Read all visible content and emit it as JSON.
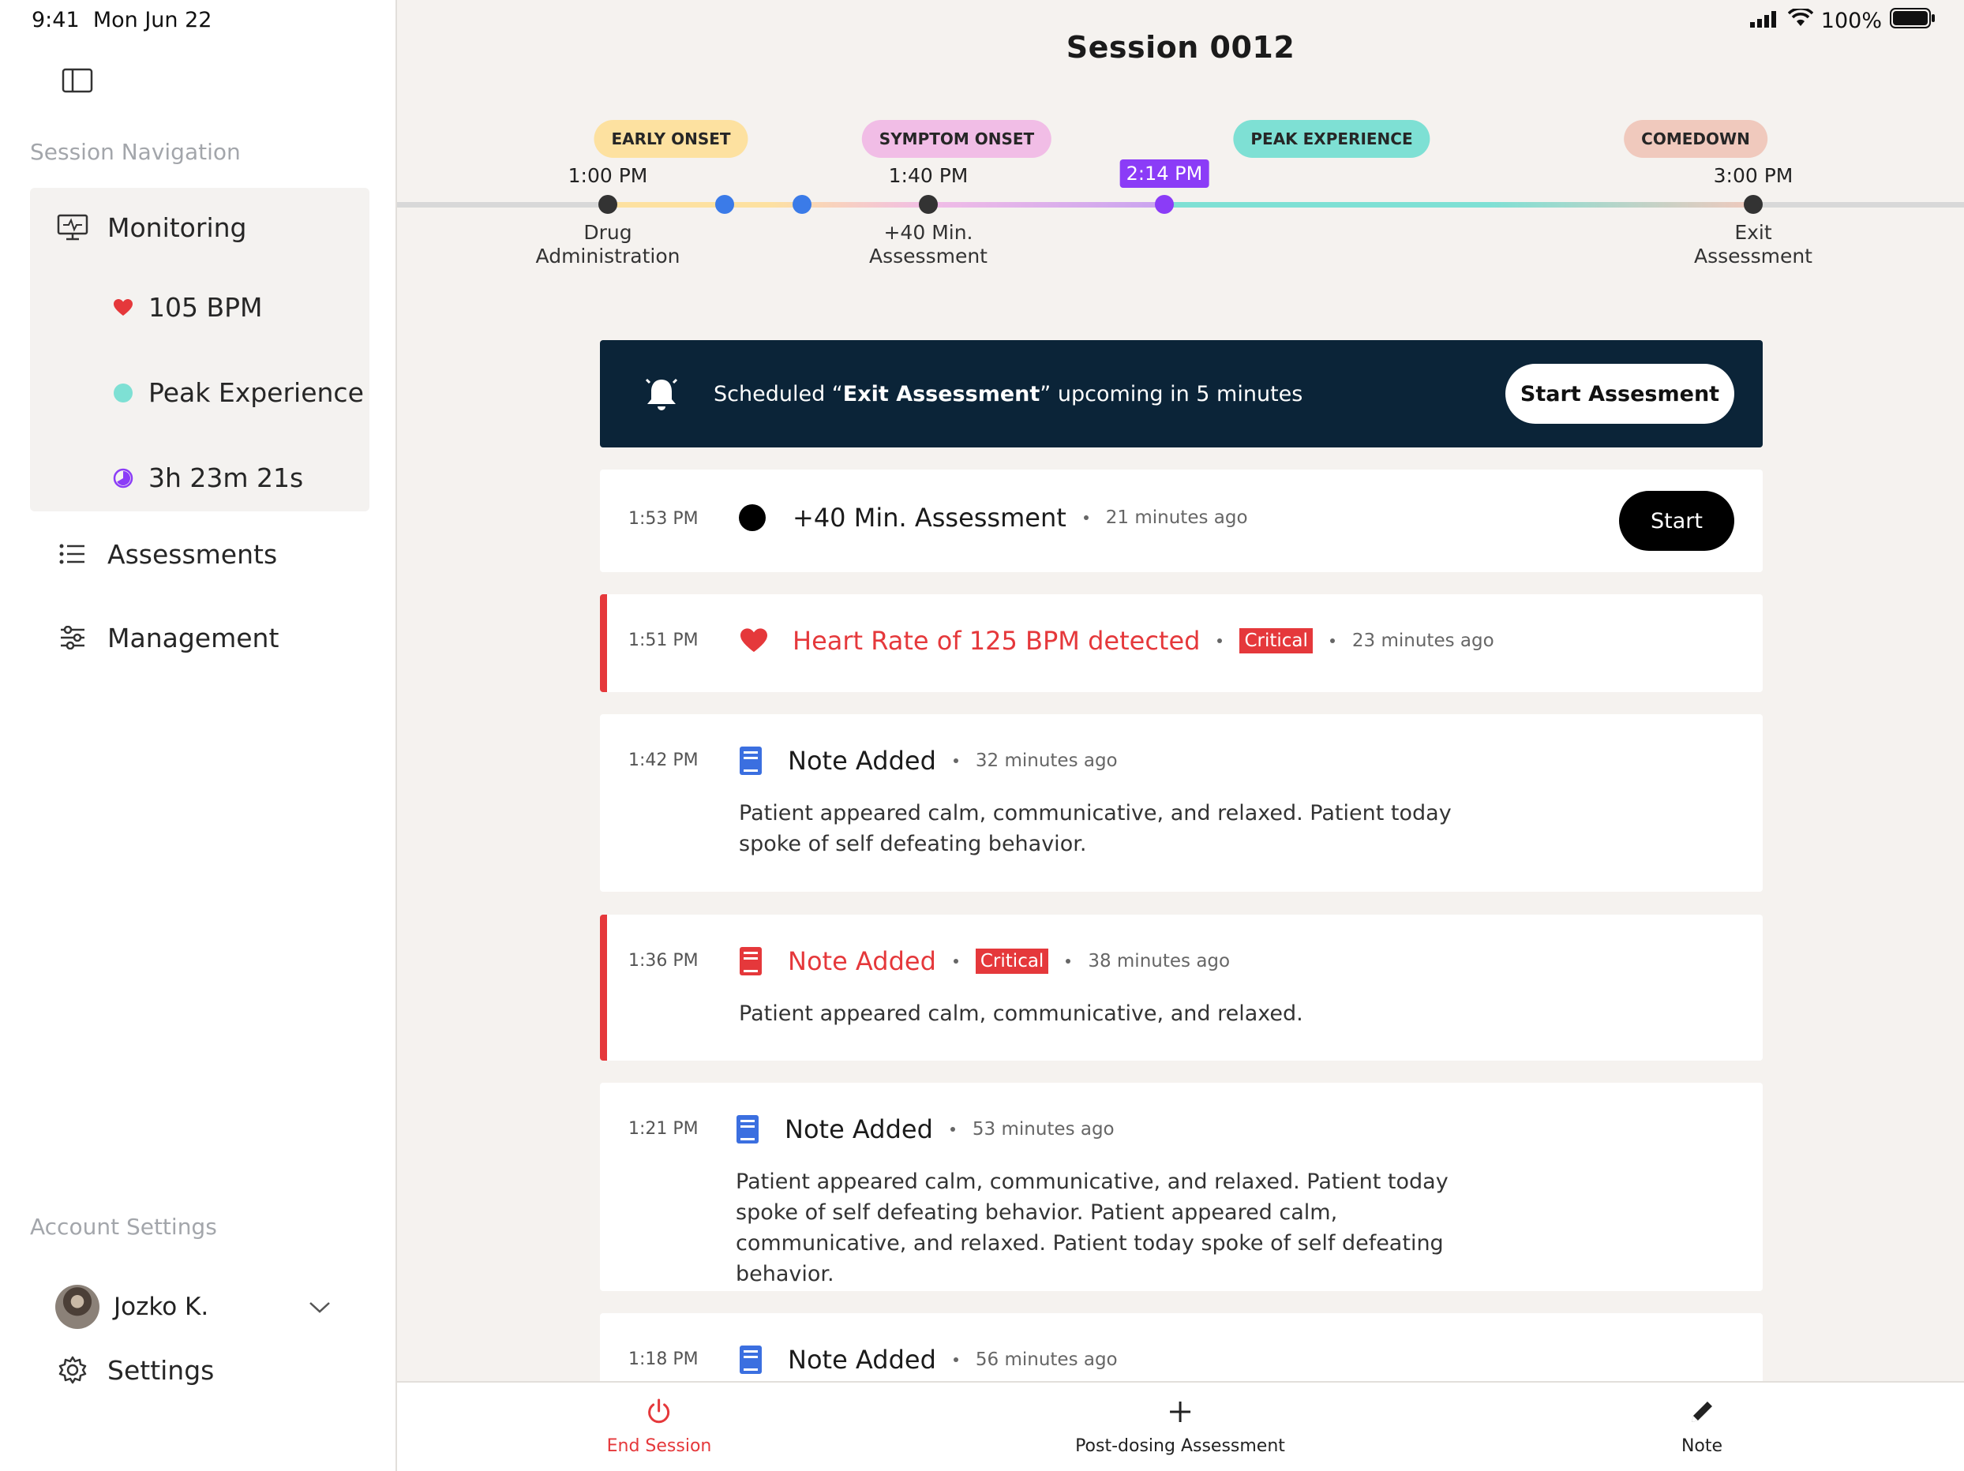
{
  "status_bar": {
    "time": "9:41",
    "date": "Mon Jun 22",
    "battery": "100%"
  },
  "session": {
    "title": "Session 0012"
  },
  "sidebar": {
    "nav_heading": "Session Navigation",
    "monitoring": {
      "label": "Monitoring",
      "heart_rate": "105 BPM",
      "phase": "Peak Experience",
      "elapsed": "3h 23m 21s"
    },
    "items": [
      {
        "label": "Assessments",
        "icon": "list-icon"
      },
      {
        "label": "Management",
        "icon": "sliders-icon"
      }
    ],
    "account_heading": "Account Settings",
    "user": {
      "name": "Jozko K."
    },
    "settings_label": "Settings"
  },
  "timeline": {
    "phases": [
      {
        "label": "EARLY ONSET",
        "color": "#fde1a0"
      },
      {
        "label": "SYMPTOM ONSET",
        "color": "#f1bde6"
      },
      {
        "label": "PEAK EXPERIENCE",
        "color": "#7ee0d4"
      },
      {
        "label": "COMEDOWN",
        "color": "#f0c9bd"
      }
    ],
    "times": [
      "1:00 PM",
      "1:40 PM",
      "3:00 PM"
    ],
    "current_time": "2:14 PM",
    "events": [
      {
        "label_line1": "Drug",
        "label_line2": "Administration"
      },
      {
        "label_line1": "+40 Min.",
        "label_line2": "Assessment"
      },
      {
        "label_line1": "Exit",
        "label_line2": "Assessment"
      }
    ]
  },
  "banner": {
    "prefix": "Scheduled “",
    "emphasis": "Exit Assessment",
    "suffix": "” upcoming in 5 minutes",
    "button": "Start Assesment"
  },
  "feed": [
    {
      "time": "1:53 PM",
      "title": "+40 Min. Assessment",
      "ago": "21 minutes ago",
      "button": "Start"
    },
    {
      "time": "1:51 PM",
      "title": "Heart Rate of 125 BPM detected",
      "badge": "Critical",
      "ago": "23 minutes ago"
    },
    {
      "time": "1:42 PM",
      "title": "Note Added",
      "ago": "32 minutes ago",
      "body": "Patient appeared calm, communicative, and relaxed. Patient today spoke of self defeating behavior."
    },
    {
      "time": "1:36 PM",
      "title": "Note Added",
      "badge": "Critical",
      "ago": "38 minutes ago",
      "body": "Patient appeared calm, communicative, and relaxed."
    },
    {
      "time": "1:21 PM",
      "title": "Note Added",
      "ago": "53 minutes ago",
      "body": "Patient appeared calm, communicative, and relaxed. Patient today spoke of self defeating behavior. Patient appeared calm, communicative, and relaxed. Patient today spoke of self defeating behavior."
    },
    {
      "time": "1:18 PM",
      "title": "Note Added",
      "ago": "56 minutes ago"
    }
  ],
  "bottom_bar": {
    "end_session": "End Session",
    "post_dosing": "Post-dosing Assessment",
    "note": "Note"
  },
  "colors": {
    "critical": "#e5383b",
    "banner_bg": "#0b2438",
    "accent_purple": "#8b3cf7",
    "note_blue": "#3b6fe0",
    "dot_blue": "#3b7be8"
  }
}
